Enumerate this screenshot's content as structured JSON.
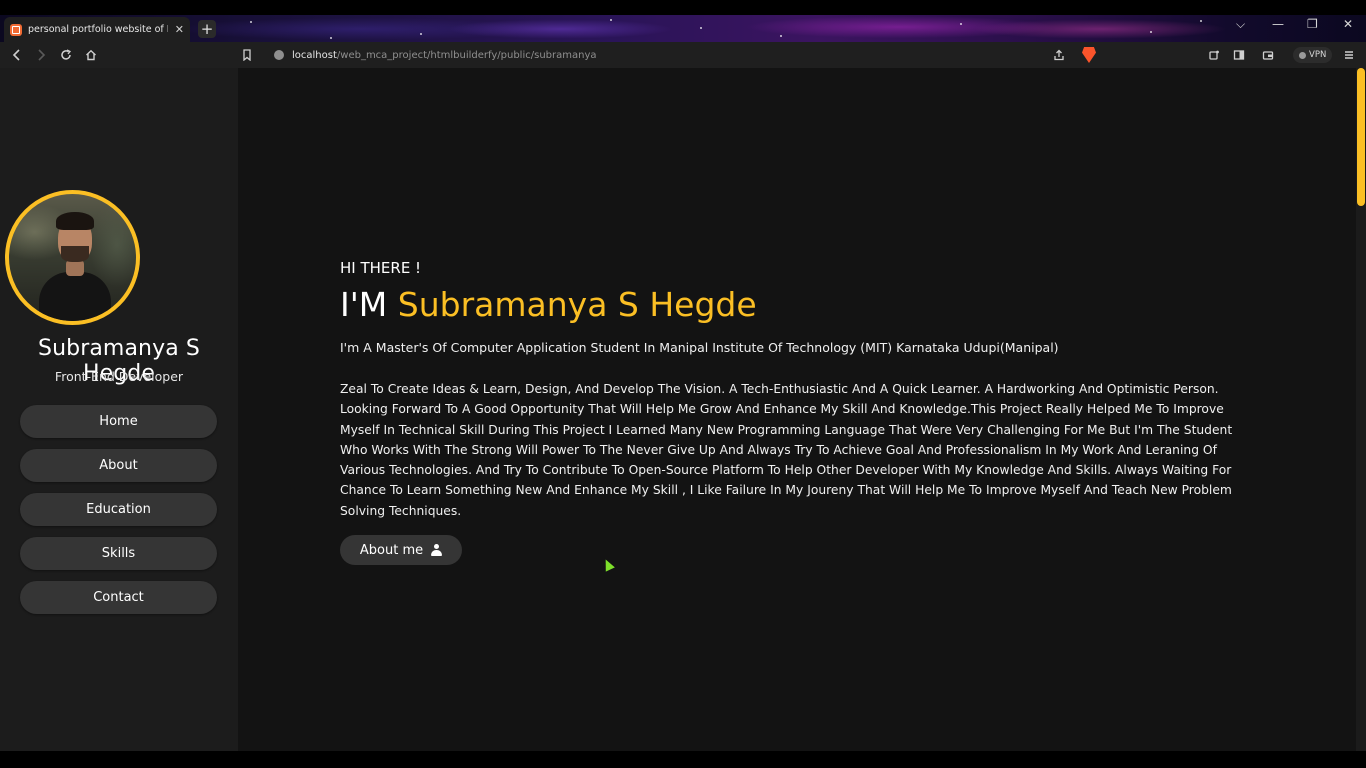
{
  "browser": {
    "tab_title": "personal portfolio website of Html",
    "tab_close": "✕",
    "new_tab": "+",
    "url_host": "localhost",
    "url_path": "/web_mca_project/htmlbuilderfy/public/subramanya",
    "vpn_label": "VPN",
    "window_controls": {
      "minimize": "—",
      "restore": "❐",
      "close": "✕",
      "dropdown": "⌵"
    },
    "toolbar_icons": [
      "back-icon",
      "forward-icon",
      "reload-icon",
      "home-icon",
      "bookmark-icon",
      "share-icon",
      "brave-shield-icon",
      "extensions-icon",
      "sidebar-icon",
      "wallet-icon",
      "menu-icon"
    ]
  },
  "profile": {
    "name": "Subramanya S Hegde",
    "role": "Front-End Developer"
  },
  "nav": {
    "items": [
      {
        "label": "Home"
      },
      {
        "label": "About"
      },
      {
        "label": "Education"
      },
      {
        "label": "Skills"
      },
      {
        "label": "Contact"
      }
    ]
  },
  "hero": {
    "greeting": "HI THERE !",
    "im_prefix": "I'M ",
    "highlight_name": "Subramanya S Hegde",
    "intro": "I'm A Master's Of Computer Application Student In Manipal Institute Of Technology (MIT) Karnataka Udupi(Manipal)",
    "bio": "Zeal To Create Ideas & Learn, Design, And Develop The Vision. A Tech-Enthusiastic And A Quick Learner. A Hardworking And Optimistic Person. Looking Forward To A Good Opportunity That Will Help Me Grow And Enhance My Skill And Knowledge.This Project Really Helped Me To Improve Myself In Technical Skill During This Project I Learned Many New Programming Language That Were Very Challenging For Me But I'm The Student Who Works With The Strong Will Power To The Never Give Up And Always Try To Achieve Goal And Professionalism In My Work And Leraning Of Various Technologies. And Try To Contribute To Open-Source Platform To Help Other Developer With My Knowledge And Skills. Always Waiting For Chance To Learn Something New And Enhance My Skill , I Like Failure In My Joureny That Will Help Me To Improve Myself And Teach New Problem Solving Techniques.",
    "button_label": "About me"
  },
  "colors": {
    "accent": "#fbbf24",
    "page_bg": "#131313",
    "sidebar_bg": "#1c1c1c",
    "button_bg": "#353535"
  }
}
